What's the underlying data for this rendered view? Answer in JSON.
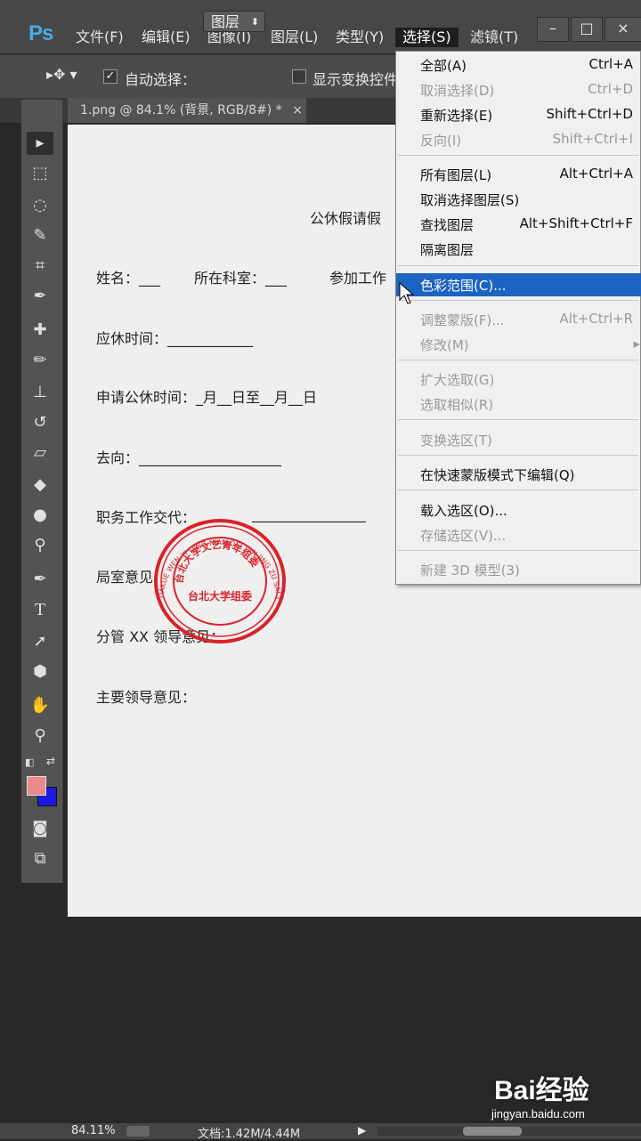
{
  "app": {
    "logo": "Ps",
    "menus": [
      "文件(F)",
      "编辑(E)",
      "图像(I)",
      "图层(L)",
      "类型(Y)",
      "选择(S)",
      "滤镜(T)"
    ],
    "window_buttons": {
      "minimize": "–",
      "restore": "□",
      "close": "×"
    }
  },
  "options_bar": {
    "auto_select_label": "自动选择：",
    "auto_select_value": "图层",
    "show_transform_label": "显示变换控件"
  },
  "document_tab": {
    "title": "1.png @ 84.1% (背景, RGB/8#) *",
    "close": "×"
  },
  "document": {
    "title": "公休假请假",
    "name_field": "姓名：___",
    "dept_field": "所在科室：___",
    "join_field": "参加工作",
    "rest_time": "应休时间：____________",
    "apply_time": "申请公休时间：_月__日至__月__日",
    "destination": "去向：____________________",
    "handover": "职务工作交代：",
    "handover_line": "________________",
    "office_opinion": "局室意见",
    "deputy_opinion": "分管 XX 领导意见：",
    "main_opinion": "主要领导意见："
  },
  "stamp": {
    "arc_text": "台北大学文艺青年组委",
    "center_text": "台北大学组委",
    "outer_text": "DAKUE WEN YI QING NIAN DEI TAN JING ZU SAI TAI BEI",
    "color": "#d8232a"
  },
  "select_menu": {
    "items": [
      {
        "label": "全部(A)",
        "shortcut": "Ctrl+A",
        "enabled": true
      },
      {
        "label": "取消选择(D)",
        "shortcut": "Ctrl+D",
        "enabled": false
      },
      {
        "label": "重新选择(E)",
        "shortcut": "Shift+Ctrl+D",
        "enabled": true
      },
      {
        "label": "反向(I)",
        "shortcut": "Shift+Ctrl+I",
        "enabled": false
      },
      {
        "label": "所有图层(L)",
        "shortcut": "Alt+Ctrl+A",
        "enabled": true
      },
      {
        "label": "取消选择图层(S)",
        "shortcut": "",
        "enabled": true
      },
      {
        "label": "查找图层",
        "shortcut": "Alt+Shift+Ctrl+F",
        "enabled": true
      },
      {
        "label": "隔离图层",
        "shortcut": "",
        "enabled": true
      },
      {
        "label": "色彩范围(C)...",
        "shortcut": "",
        "enabled": true,
        "highlighted": true
      },
      {
        "label": "调整蒙版(F)...",
        "shortcut": "Alt+Ctrl+R",
        "enabled": false
      },
      {
        "label": "修改(M)",
        "shortcut": "▸",
        "enabled": false
      },
      {
        "label": "扩大选取(G)",
        "shortcut": "",
        "enabled": false
      },
      {
        "label": "选取相似(R)",
        "shortcut": "",
        "enabled": false
      },
      {
        "label": "变换选区(T)",
        "shortcut": "",
        "enabled": false
      },
      {
        "label": "在快速蒙版模式下编辑(Q)",
        "shortcut": "",
        "enabled": true
      },
      {
        "label": "载入选区(O)...",
        "shortcut": "",
        "enabled": true
      },
      {
        "label": "存储选区(V)...",
        "shortcut": "",
        "enabled": false
      },
      {
        "label": "新建 3D 模型(3)",
        "shortcut": "",
        "enabled": false
      }
    ]
  },
  "status_bar": {
    "zoom": "84.11%",
    "doc_size": "文档:1.42M/4.44M"
  },
  "colors": {
    "foreground": "#e88a8a",
    "background": "#1a1ae0",
    "menu_highlight": "#1c63c2"
  },
  "watermark": {
    "brand": "Bai经验",
    "url": "jingyan.baidu.com"
  }
}
